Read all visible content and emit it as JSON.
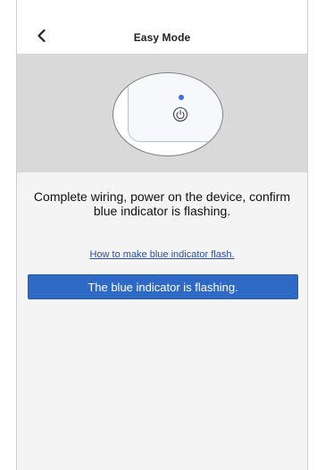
{
  "header": {
    "title": "Easy Mode",
    "back_icon": "back-chevron"
  },
  "hero": {
    "device_icon": "smart-device-illustration",
    "power_icon": "power-icon",
    "indicator_color": "#3a6ee8"
  },
  "instructions": {
    "text": "Complete wiring, power on the device, confirm blue indicator is flashing."
  },
  "help": {
    "link_text": "How to make blue indicator flash."
  },
  "actions": {
    "confirm_button": "The blue indicator is flashing."
  },
  "colors": {
    "accent": "#2f69c6",
    "link": "#2b4fa8",
    "hero_bg": "#d9d9d9",
    "page_bg": "#f4f4f4"
  }
}
